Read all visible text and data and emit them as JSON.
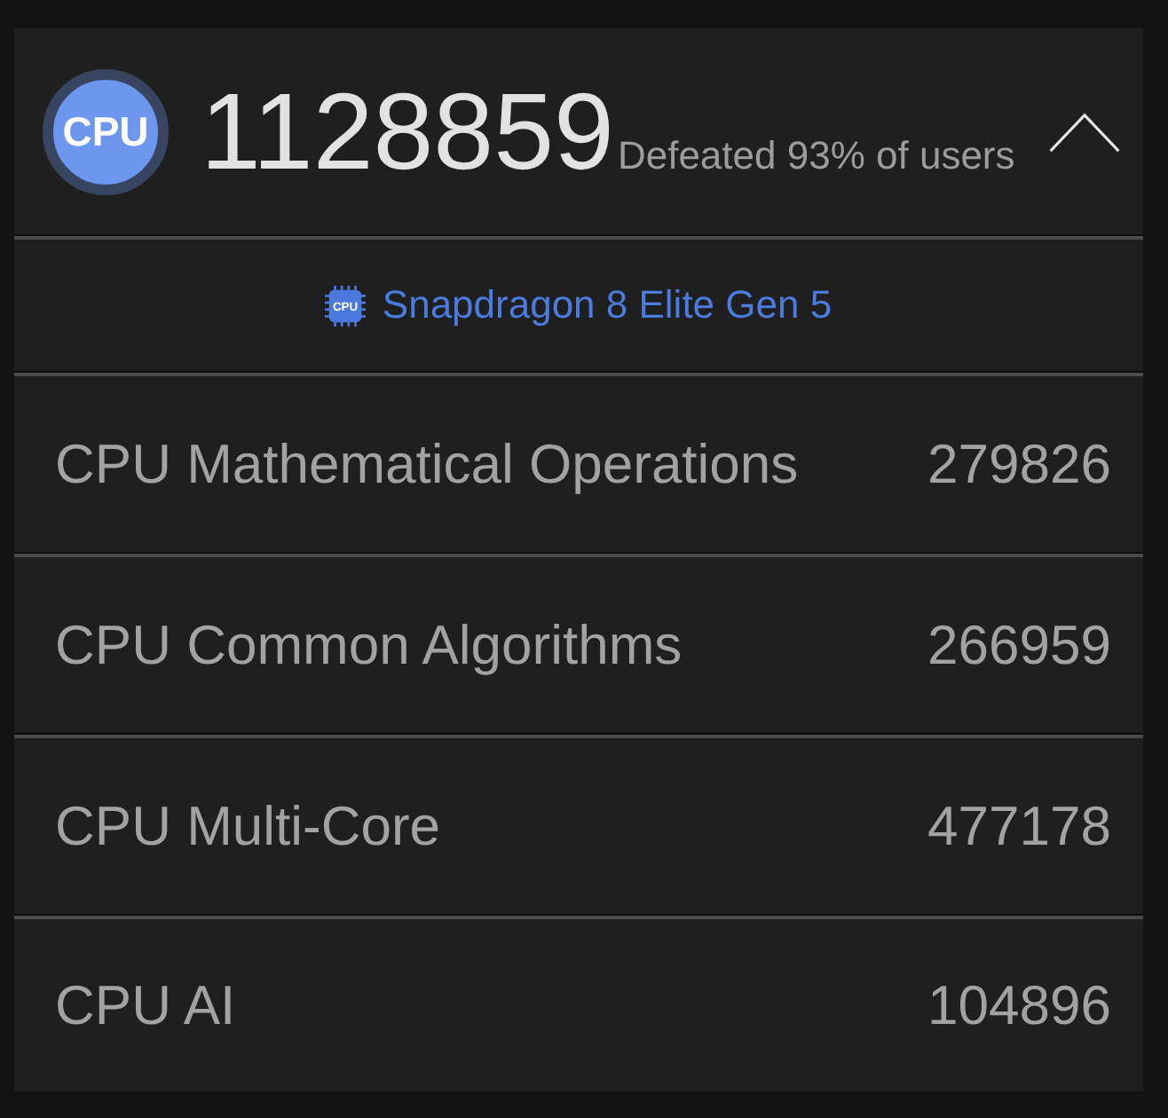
{
  "score_card": {
    "badge": "CPU",
    "score": "1128859",
    "rank_text": "Defeated 93% of users",
    "expanded": true
  },
  "processor": {
    "chip_label": "CPU",
    "name": "Snapdragon 8 Elite Gen 5"
  },
  "subscores": [
    {
      "label": "CPU Mathematical Operations",
      "value": "279826"
    },
    {
      "label": "CPU Common Algorithms",
      "value": "266959"
    },
    {
      "label": "CPU Multi-Core",
      "value": "477178"
    },
    {
      "label": "CPU AI",
      "value": "104896"
    }
  ]
}
